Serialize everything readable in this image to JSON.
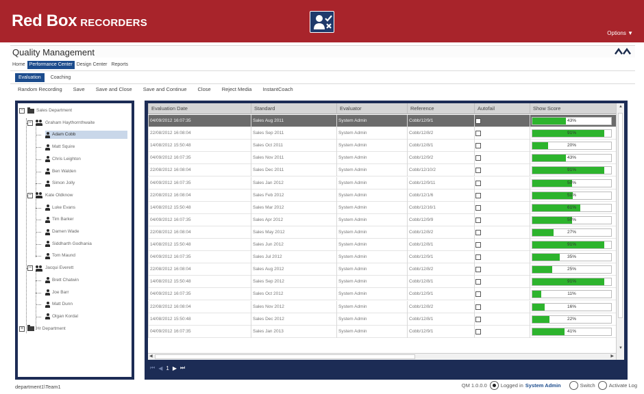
{
  "header": {
    "logo_main": "Red Box",
    "logo_sub": "RECORDERS",
    "options_label": "Options ▼"
  },
  "page": {
    "title": "Quality Management",
    "collapse_glyph": "^^"
  },
  "nav": {
    "items": [
      {
        "label": "Home",
        "active": false
      },
      {
        "label": "Performance Center",
        "active": true
      },
      {
        "label": "Design Center",
        "active": false
      },
      {
        "label": "Reports",
        "active": false
      }
    ]
  },
  "subnav": {
    "items": [
      {
        "label": "Evaluation",
        "active": true
      },
      {
        "label": "Coaching",
        "active": false
      }
    ]
  },
  "toolbar": {
    "items": [
      "Random Recording",
      "Save",
      "Save and Close",
      "Save and Continue",
      "Close",
      "Reject Media",
      "InstantCoach"
    ]
  },
  "tree": {
    "nodes": [
      {
        "label": "Sales Department",
        "type": "department",
        "level": 0,
        "expanded": true
      },
      {
        "label": "Graham Haythornthwaite",
        "type": "team",
        "level": 1,
        "expanded": true
      },
      {
        "label": "Adam Cobb",
        "type": "user",
        "level": 2,
        "selected": true
      },
      {
        "label": "Matt Squire",
        "type": "user",
        "level": 2
      },
      {
        "label": "Chris Leighton",
        "type": "user",
        "level": 2
      },
      {
        "label": "Ben Walden",
        "type": "user",
        "level": 2
      },
      {
        "label": "Simon Jolly",
        "type": "user",
        "level": 2
      },
      {
        "label": "Kate Oldknow",
        "type": "team",
        "level": 1,
        "expanded": true
      },
      {
        "label": "Luke Evans",
        "type": "user",
        "level": 2
      },
      {
        "label": "Tim Barker",
        "type": "user",
        "level": 2
      },
      {
        "label": "Damen Wade",
        "type": "user",
        "level": 2
      },
      {
        "label": "Siddharth Godhania",
        "type": "user",
        "level": 2
      },
      {
        "label": "Tom Maund",
        "type": "user",
        "level": 2
      },
      {
        "label": "Jacqui Everett",
        "type": "team",
        "level": 1,
        "expanded": true
      },
      {
        "label": "Brett Chatwin",
        "type": "user",
        "level": 2
      },
      {
        "label": "Joe Barr",
        "type": "user",
        "level": 2
      },
      {
        "label": "Matt Dunn",
        "type": "user",
        "level": 2
      },
      {
        "label": "Olgan Kordal",
        "type": "user",
        "level": 2
      },
      {
        "label": "Hr Department",
        "type": "department",
        "level": 0,
        "expanded": false
      }
    ]
  },
  "grid": {
    "headers": [
      "Evaluation Date",
      "Standard",
      "Evaluator",
      "Reference",
      "Autofail",
      "Show Score"
    ],
    "rows": [
      {
        "date": "04/09/2012 16:07:35",
        "standard": "Sales Aug 2011",
        "evaluator": "System Admin",
        "reference": "Cobb/12/9/1",
        "autofail": false,
        "score": 43,
        "score_label": "43%",
        "selected": true
      },
      {
        "date": "22/08/2012 16:08:04",
        "standard": "Sales Sep 2011",
        "evaluator": "System Admin",
        "reference": "Cobb/12/8/2",
        "autofail": false,
        "score": 91,
        "score_label": "91%"
      },
      {
        "date": "14/08/2012 15:50:48",
        "standard": "Sales Oct 2011",
        "evaluator": "System Admin",
        "reference": "Cobb/12/8/1",
        "autofail": false,
        "score": 20,
        "score_label": "20%"
      },
      {
        "date": "04/09/2012 16:07:35",
        "standard": "Sales Nov 2011",
        "evaluator": "System Admin",
        "reference": "Cobb/12/9/2",
        "autofail": false,
        "score": 43,
        "score_label": "43%"
      },
      {
        "date": "22/08/2012 16:08:04",
        "standard": "Sales Dec 2011",
        "evaluator": "System Admin",
        "reference": "Cobb/12/10/2",
        "autofail": false,
        "score": 91,
        "score_label": "91%"
      },
      {
        "date": "04/09/2012 16:07:35",
        "standard": "Sales Jan 2012",
        "evaluator": "System Admin",
        "reference": "Cobb/12/9/11",
        "autofail": false,
        "score": 50,
        "score_label": "50%"
      },
      {
        "date": "22/08/2012 16:08:04",
        "standard": "Sales Feb 2012",
        "evaluator": "System Admin",
        "reference": "Cobb/12/1/6",
        "autofail": false,
        "score": 51,
        "score_label": "51%"
      },
      {
        "date": "14/08/2012 15:50:48",
        "standard": "Sales Mar 2012",
        "evaluator": "System Admin",
        "reference": "Cobb/12/16/1",
        "autofail": false,
        "score": 61,
        "score_label": "61%"
      },
      {
        "date": "04/09/2012 16:07:35",
        "standard": "Sales Apr 2012",
        "evaluator": "System Admin",
        "reference": "Cobb/12/9/9",
        "autofail": false,
        "score": 50,
        "score_label": "50%"
      },
      {
        "date": "22/08/2012 16:08:04",
        "standard": "Sales May 2012",
        "evaluator": "System Admin",
        "reference": "Cobb/12/8/2",
        "autofail": false,
        "score": 27,
        "score_label": "27%"
      },
      {
        "date": "14/08/2012 15:50:48",
        "standard": "Sales Jun 2012",
        "evaluator": "System Admin",
        "reference": "Cobb/12/8/1",
        "autofail": false,
        "score": 91,
        "score_label": "91%"
      },
      {
        "date": "04/09/2012 16:07:35",
        "standard": "Sales Jul 2012",
        "evaluator": "System Admin",
        "reference": "Cobb/12/9/1",
        "autofail": false,
        "score": 35,
        "score_label": "35%"
      },
      {
        "date": "22/08/2012 16:08:04",
        "standard": "Sales Aug 2012",
        "evaluator": "System Admin",
        "reference": "Cobb/12/8/2",
        "autofail": false,
        "score": 25,
        "score_label": "25%"
      },
      {
        "date": "14/08/2012 15:50:48",
        "standard": "Sales Sep 2012",
        "evaluator": "System Admin",
        "reference": "Cobb/12/8/1",
        "autofail": false,
        "score": 91,
        "score_label": "91%"
      },
      {
        "date": "04/09/2012 16:07:35",
        "standard": "Sales Oct 2012",
        "evaluator": "System Admin",
        "reference": "Cobb/12/9/1",
        "autofail": false,
        "score": 11,
        "score_label": "11%"
      },
      {
        "date": "22/08/2012 16:08:04",
        "standard": "Sales Nov 2012",
        "evaluator": "System Admin",
        "reference": "Cobb/12/8/2",
        "autofail": false,
        "score": 16,
        "score_label": "16%"
      },
      {
        "date": "14/08/2012 15:50:48",
        "standard": "Sales Dec 2012",
        "evaluator": "System Admin",
        "reference": "Cobb/12/8/1",
        "autofail": false,
        "score": 22,
        "score_label": "22%"
      },
      {
        "date": "04/09/2012 16:07:35",
        "standard": "Sales Jan 2013",
        "evaluator": "System Admin",
        "reference": "Cobb/12/9/1",
        "autofail": false,
        "score": 41,
        "score_label": "41%"
      }
    ]
  },
  "pager": {
    "first": "⏮",
    "prev": "◀",
    "page": "1",
    "next": "▶",
    "last": "⏭"
  },
  "status": {
    "path": "department1\\Team1",
    "version": "QM 1.0.0.0",
    "logged_prefix": "Logged in",
    "user": "System Admin",
    "switch_label": "Switch",
    "activate_log_label": "Activate Log"
  },
  "colors": {
    "brand_red": "#a8242b",
    "navy": "#1c2c55",
    "accent_blue": "#1c4c8d",
    "score_green": "#2db42d"
  },
  "icons": {
    "app": "user-check-icon",
    "department": "folder-icon",
    "team": "group-icon",
    "user": "user-icon"
  }
}
